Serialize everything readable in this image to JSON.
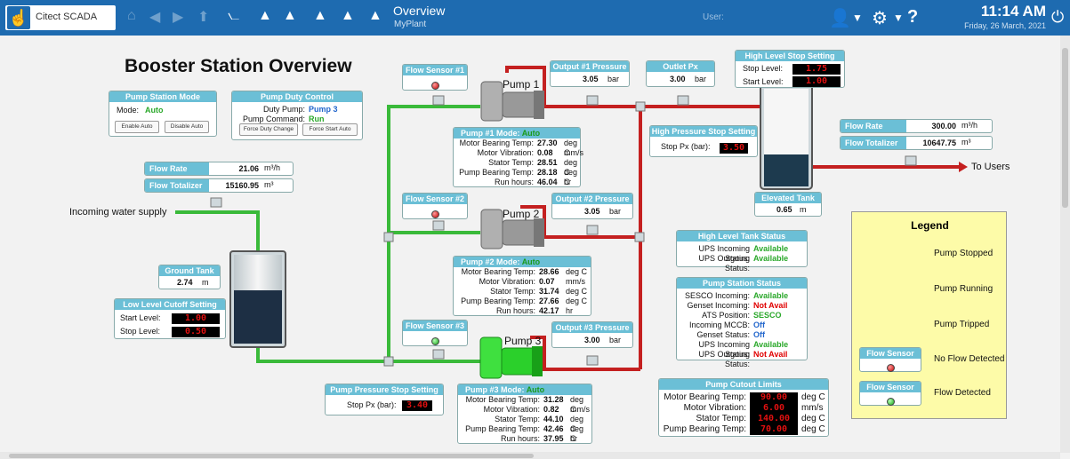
{
  "topbar": {
    "app_name": "Citect SCADA",
    "title": "Overview",
    "subtitle": "MyPlant",
    "user_label": "User:",
    "time": "11:14 AM",
    "date": "Friday, 26 March, 2021"
  },
  "page_title": "Booster Station Overview",
  "pump_station_mode": {
    "header": "Pump Station Mode",
    "mode_label": "Mode:",
    "mode_value": "Auto",
    "enable_btn": "Enable Auto",
    "disable_btn": "Disable Auto"
  },
  "pump_duty": {
    "header": "Pump Duty Control",
    "duty_label": "Duty Pump:",
    "duty_value": "Pump 3",
    "cmd_label": "Pump Command:",
    "cmd_value": "Run",
    "btn1": "Force Duty Change",
    "btn2": "Force Start Auto"
  },
  "inlet": {
    "flow_rate_label": "Flow Rate",
    "flow_rate_value": "21.06",
    "flow_rate_unit": "m³/h",
    "totalizer_label": "Flow Totalizer",
    "totalizer_value": "15160.95",
    "totalizer_unit": "m³",
    "supply_label": "Incoming water supply"
  },
  "ground_tank": {
    "header": "Ground Tank",
    "value": "2.74",
    "unit": "m"
  },
  "low_level": {
    "header": "Low Level Cutoff Setting",
    "start_label": "Start Level:",
    "start_value": "1.00",
    "stop_label": "Stop Level:",
    "stop_value": "0.50"
  },
  "pump_pressure_stop": {
    "header": "Pump Pressure Stop Setting",
    "label": "Stop Px (bar):",
    "value": "3.40"
  },
  "flow_sensors": [
    {
      "header": "Flow Sensor #1",
      "state": "red"
    },
    {
      "header": "Flow Sensor #2",
      "state": "red"
    },
    {
      "header": "Flow Sensor #3",
      "state": "green"
    }
  ],
  "pumps": [
    {
      "name": "Pump 1",
      "mode_label": "Pump #1 Mode:",
      "mode": "Auto",
      "rows": [
        {
          "label": "Motor Bearing Temp:",
          "value": "27.30",
          "unit": "deg C"
        },
        {
          "label": "Motor Vibration:",
          "value": "0.08",
          "unit": "mm/s"
        },
        {
          "label": "Stator Temp:",
          "value": "28.51",
          "unit": "deg C"
        },
        {
          "label": "Pump Bearing Temp:",
          "value": "28.18",
          "unit": "deg C"
        },
        {
          "label": "Run hours:",
          "value": "46.04",
          "unit": "hr"
        }
      ]
    },
    {
      "name": "Pump 2",
      "mode_label": "Pump #2 Mode:",
      "mode": "Auto",
      "rows": [
        {
          "label": "Motor Bearing Temp:",
          "value": "28.66",
          "unit": "deg C"
        },
        {
          "label": "Motor Vibration:",
          "value": "0.07",
          "unit": "mm/s"
        },
        {
          "label": "Stator Temp:",
          "value": "31.74",
          "unit": "deg C"
        },
        {
          "label": "Pump Bearing Temp:",
          "value": "27.66",
          "unit": "deg C"
        },
        {
          "label": "Run hours:",
          "value": "42.17",
          "unit": "hr"
        }
      ]
    },
    {
      "name": "Pump 3",
      "mode_label": "Pump #3 Mode:",
      "mode": "Auto",
      "rows": [
        {
          "label": "Motor Bearing Temp:",
          "value": "31.28",
          "unit": "deg C"
        },
        {
          "label": "Motor Vibration:",
          "value": "0.82",
          "unit": "mm/s"
        },
        {
          "label": "Stator Temp:",
          "value": "44.10",
          "unit": "deg C"
        },
        {
          "label": "Pump Bearing Temp:",
          "value": "42.46",
          "unit": "deg C"
        },
        {
          "label": "Run hours:",
          "value": "37.95",
          "unit": "hr"
        }
      ]
    }
  ],
  "output_pressures": [
    {
      "header": "Output #1 Pressure",
      "value": "3.05",
      "unit": "bar"
    },
    {
      "header": "Output #2 Pressure",
      "value": "3.05",
      "unit": "bar"
    },
    {
      "header": "Output #3 Pressure",
      "value": "3.00",
      "unit": "bar"
    }
  ],
  "outlet_px": {
    "header": "Outlet Px",
    "value": "3.00",
    "unit": "bar"
  },
  "high_pressure_stop": {
    "header": "High Pressure Stop Setting",
    "label": "Stop Px (bar):",
    "value": "3.50"
  },
  "high_level_stop": {
    "header": "High Level Stop Setting",
    "stop_label": "Stop Level:",
    "stop_value": "1.75",
    "start_label": "Start Level:",
    "start_value": "1.00"
  },
  "elevated_tank": {
    "header": "Elevated Tank",
    "value": "0.65",
    "unit": "m"
  },
  "outlet": {
    "flow_rate_label": "Flow Rate",
    "flow_rate_value": "300.00",
    "flow_rate_unit": "m³/h",
    "totalizer_label": "Flow Totalizer",
    "totalizer_value": "10647.75",
    "totalizer_unit": "m³",
    "to_users": "To Users"
  },
  "high_level_tank_status": {
    "header": "High Level Tank Status",
    "rows": [
      {
        "label": "UPS Incoming Status:",
        "value": "Available",
        "state": "green"
      },
      {
        "label": "UPS Outgoing Status:",
        "value": "Available",
        "state": "green"
      }
    ]
  },
  "pump_station_status": {
    "header": "Pump Station Status",
    "rows": [
      {
        "label": "SESCO Incoming:",
        "value": "Available",
        "state": "green"
      },
      {
        "label": "Genset Incoming:",
        "value": "Not Avail",
        "state": "red"
      },
      {
        "label": "ATS Position:",
        "value": "SESCO",
        "state": "green"
      },
      {
        "label": "Incoming MCCB:",
        "value": "Off",
        "state": "blue"
      },
      {
        "label": "Genset Status:",
        "value": "Off",
        "state": "blue"
      },
      {
        "label": "UPS Incoming Status:",
        "value": "Available",
        "state": "green"
      },
      {
        "label": "UPS Outgoing Status:",
        "value": "Not Avail",
        "state": "red"
      }
    ]
  },
  "pump_cutout": {
    "header": "Pump Cutout Limits",
    "rows": [
      {
        "label": "Motor Bearing Temp:",
        "value": "90.00",
        "unit": "deg C"
      },
      {
        "label": "Motor Vibration:",
        "value": "6.00",
        "unit": "mm/s"
      },
      {
        "label": "Stator Temp:",
        "value": "140.00",
        "unit": "deg C"
      },
      {
        "label": "Pump Bearing Temp:",
        "value": "70.00",
        "unit": "deg C"
      }
    ]
  },
  "legend": {
    "title": "Legend",
    "stopped": "Pump Stopped",
    "running": "Pump Running",
    "tripped": "Pump Tripped",
    "sensor_header": "Flow Sensor",
    "no_flow": "No Flow Detected",
    "flow": "Flow Detected",
    "colors": {
      "stopped": "#9a9a9a",
      "running": "#3fe03f",
      "tripped": "#e83030"
    }
  }
}
